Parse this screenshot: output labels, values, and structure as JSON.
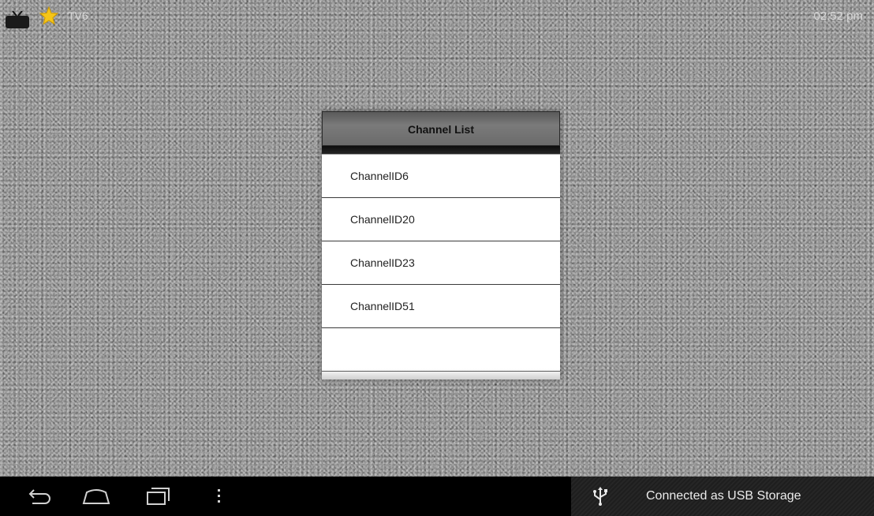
{
  "status": {
    "channel_name": "TV6",
    "clock": "02:52 pm"
  },
  "dialog": {
    "title": "Channel List",
    "channels": [
      {
        "label": "ChannelID6"
      },
      {
        "label": "ChannelID20"
      },
      {
        "label": "ChannelID23"
      },
      {
        "label": "ChannelID51"
      },
      {
        "label": ""
      }
    ]
  },
  "navbar": {
    "back_icon": "back-icon",
    "home_icon": "home-icon",
    "recents_icon": "recent-apps-icon",
    "menu_icon": "overflow-menu-icon"
  },
  "notification": {
    "icon": "usb-icon",
    "text": "Connected as USB Storage"
  },
  "colors": {
    "static_gray": "#8a8a8a",
    "header_gray": "#6b6b6b",
    "list_bg": "#ffffff",
    "nav_bg": "#000000",
    "star_yellow": "#f5c518"
  }
}
